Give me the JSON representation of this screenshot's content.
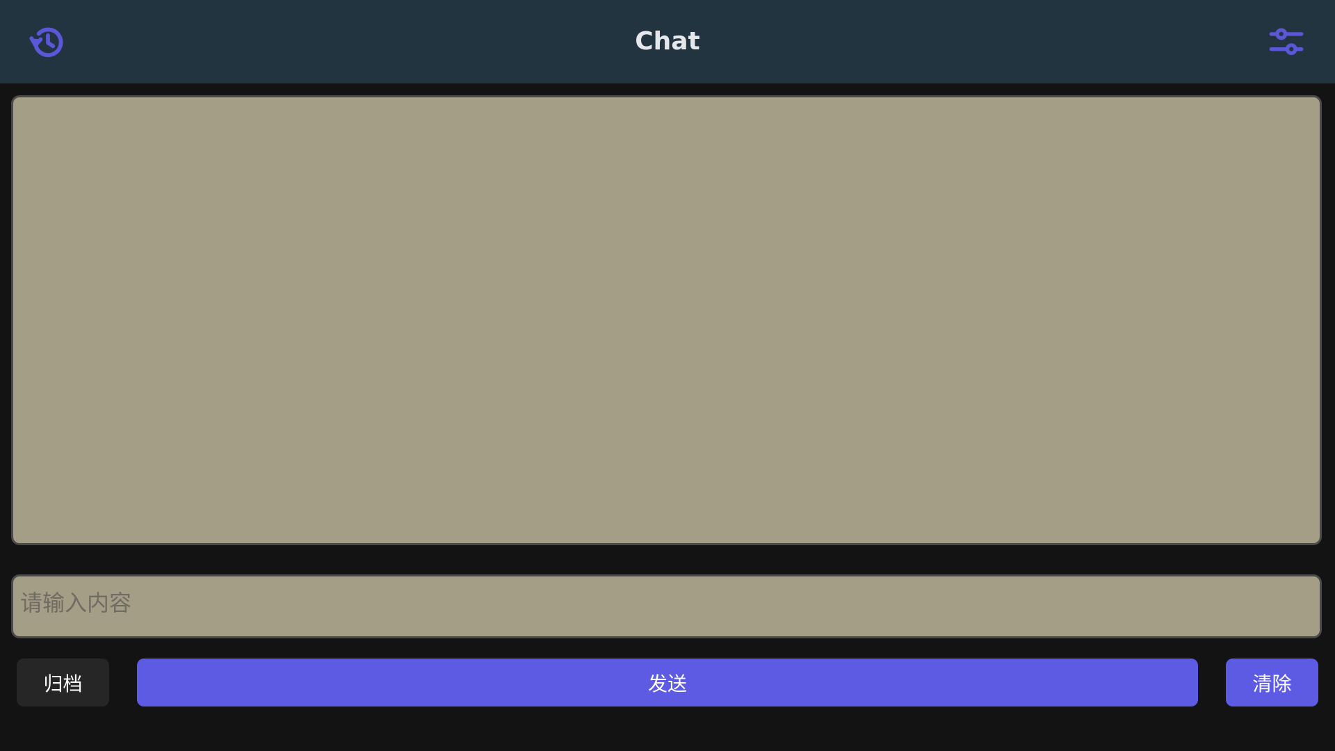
{
  "header": {
    "title": "Chat",
    "left_icon": "history-icon",
    "right_icon": "sliders-settings-icon"
  },
  "chat": {
    "messages": []
  },
  "input": {
    "value": "",
    "placeholder": "请输入内容"
  },
  "actions": {
    "archive_label": "归档",
    "send_label": "发送",
    "clear_label": "清除"
  },
  "colors": {
    "header_bg": "#233441",
    "page_bg": "#131313",
    "panel_bg": "#a59e86",
    "accent": "#5d5ae3",
    "secondary_button": "#262626"
  }
}
